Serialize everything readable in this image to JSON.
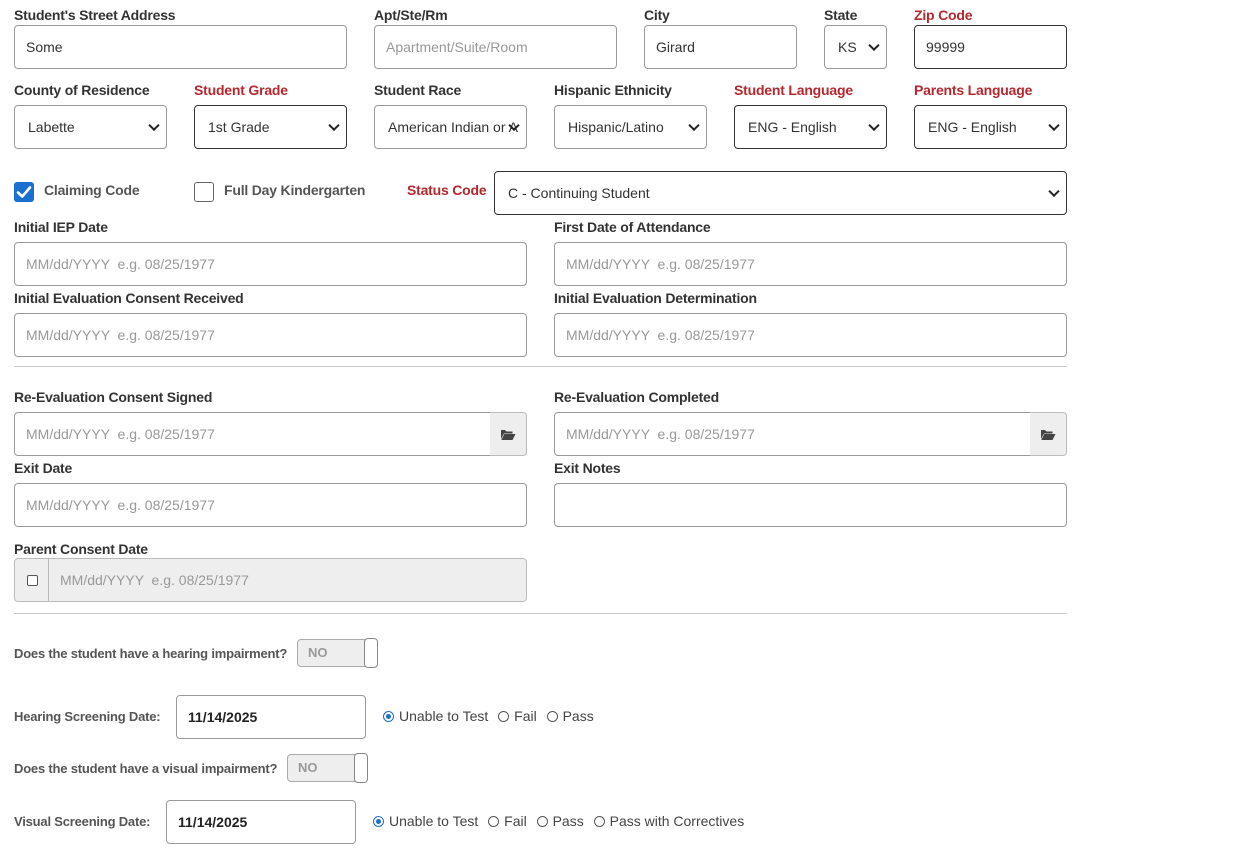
{
  "address": {
    "street_label": "Student's Street Address",
    "street_value": "Some",
    "apt_label": "Apt/Ste/Rm",
    "apt_placeholder": "Apartment/Suite/Room",
    "city_label": "City",
    "city_value": "Girard",
    "state_label": "State",
    "state_value": "KS",
    "zip_label": "Zip Code",
    "zip_value": "99999"
  },
  "demographics": {
    "county_label": "County of Residence",
    "county_value": "Labette",
    "grade_label": "Student Grade",
    "grade_value": "1st Grade",
    "race_label": "Student Race",
    "race_value": "American Indian or A",
    "ethnicity_label": "Hispanic Ethnicity",
    "ethnicity_value": "Hispanic/Latino",
    "student_language_label": "Student Language",
    "student_language_value": "ENG - English",
    "parents_language_label": "Parents Language",
    "parents_language_value": "ENG - English"
  },
  "codes": {
    "claiming_code_label": "Claiming Code",
    "claiming_code_checked": true,
    "full_day_k_label": "Full Day Kindergarten",
    "full_day_k_checked": false,
    "status_code_label": "Status Code",
    "status_code_value": "C - Continuing Student"
  },
  "date_placeholder": "MM/dd/YYYY  e.g. 08/25/1977",
  "dates": {
    "initial_iep_label": "Initial IEP Date",
    "first_attendance_label": "First Date of Attendance",
    "initial_eval_consent_label": "Initial Evaluation Consent Received",
    "initial_eval_determination_label": "Initial Evaluation Determination",
    "reeval_consent_label": "Re-Evaluation Consent Signed",
    "reeval_completed_label": "Re-Evaluation Completed",
    "exit_date_label": "Exit Date",
    "exit_notes_label": "Exit Notes",
    "parent_consent_label": "Parent Consent Date"
  },
  "screening": {
    "hearing_question": "Does the student have a hearing impairment?",
    "hearing_toggle": "NO",
    "hearing_date_label": "Hearing Screening Date:",
    "hearing_date_value": "11/14/2025",
    "hearing_options": [
      "Unable to Test",
      "Fail",
      "Pass"
    ],
    "hearing_selected": "Unable to Test",
    "visual_question": "Does the student have a visual impairment?",
    "visual_toggle": "NO",
    "visual_date_label": "Visual Screening Date:",
    "visual_date_value": "11/14/2025",
    "visual_options": [
      "Unable to Test",
      "Fail",
      "Pass",
      "Pass with Correctives"
    ],
    "visual_selected": "Unable to Test"
  },
  "colors": {
    "required_label": "#b5282d",
    "checkbox_checked": "#1a6fd1",
    "disabled_background": "#eeeeee"
  },
  "icons": {
    "date_picker": "folder-open-icon",
    "select_arrow": "chevron-down-icon"
  }
}
